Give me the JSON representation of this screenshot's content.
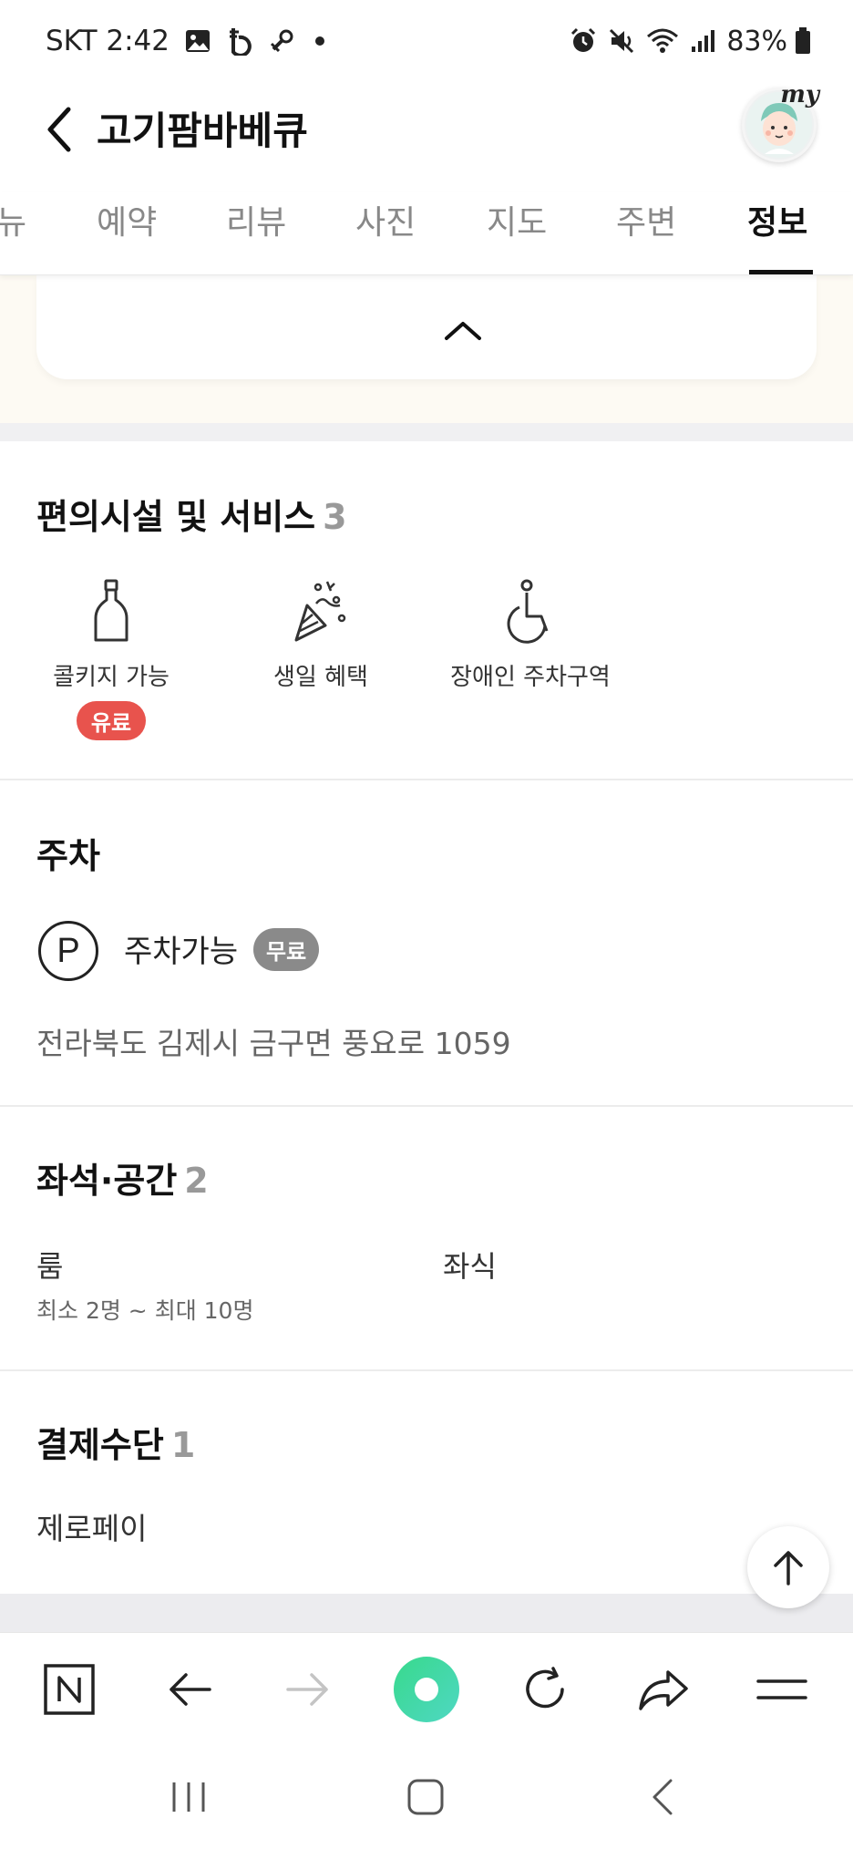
{
  "status_bar": {
    "carrier_time": "SKT 2:42",
    "battery": "83%",
    "icons_left": [
      "gallery-icon",
      "b-badge-icon",
      "link-icon",
      "dot-icon"
    ],
    "icons_right": [
      "alarm-icon",
      "mute-icon",
      "wifi-icon",
      "signal-icon",
      "battery-icon"
    ]
  },
  "header": {
    "title": "고기팜바베큐",
    "avatar_label": "my"
  },
  "tabs": [
    {
      "label": "뉴"
    },
    {
      "label": "예약"
    },
    {
      "label": "리뷰"
    },
    {
      "label": "사진"
    },
    {
      "label": "지도"
    },
    {
      "label": "주변"
    },
    {
      "label": "정보",
      "active": true
    }
  ],
  "facilities": {
    "title": "편의시설 및 서비스",
    "count": "3",
    "items": [
      {
        "label": "콜키지 가능",
        "badge": "유료",
        "icon": "wine-bottle-icon"
      },
      {
        "label": "생일 혜택",
        "icon": "party-popper-icon"
      },
      {
        "label": "장애인 주차구역",
        "icon": "wheelchair-icon"
      }
    ]
  },
  "parking": {
    "title": "주차",
    "symbol": "P",
    "status": "주차가능",
    "badge": "무료",
    "address": "전라북도 김제시 금구면 풍요로 1059"
  },
  "seating": {
    "title": "좌석·공간",
    "count": "2",
    "items": [
      {
        "name": "룸",
        "detail": "최소 2명 ~ 최대 10명"
      },
      {
        "name": "좌식"
      }
    ]
  },
  "payment": {
    "title": "결제수단",
    "count": "1",
    "items": [
      "제로페이"
    ]
  },
  "colors": {
    "badge_paid": "#e8534d",
    "badge_free": "#8a8a8a",
    "accent_green": "#38d98c",
    "cream_bg": "#fdfaf3"
  }
}
